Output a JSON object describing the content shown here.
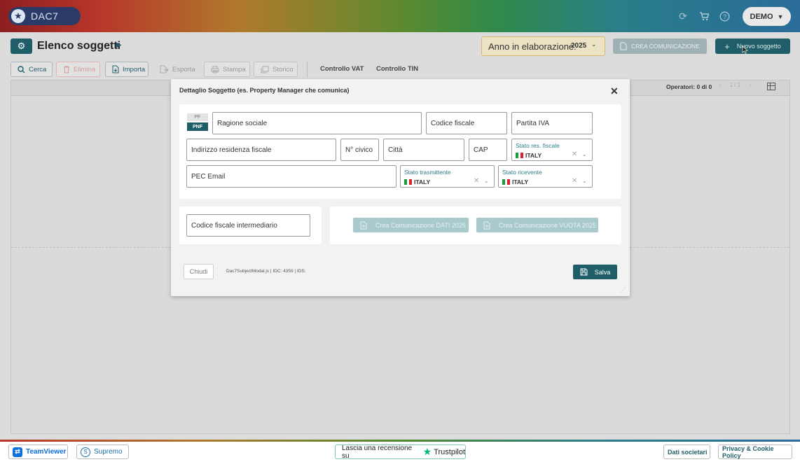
{
  "header": {
    "logo_text": "DAC7",
    "user_label": "DEMO",
    "icons": [
      "sync-icon",
      "cart-icon",
      "help-icon"
    ]
  },
  "title_bar": {
    "page_title": "Elenco soggetti",
    "anno_label": "Anno in elaborazione:",
    "anno_value": "2025",
    "crea_comunicazione_label": "CREA COMUNICAZIONE",
    "nuovo_soggetto_label": "Nuovo soggetto"
  },
  "toolbar": {
    "cerca": "Cerca",
    "elimina": "Elimina",
    "importa": "Importa",
    "esporta": "Esporta",
    "stampa": "Stampa",
    "storico": "Storico",
    "controllo_vat": "Controllo VAT",
    "controllo_tin": "Controllo TIN"
  },
  "table": {
    "operatori": "Operatori: 0 di 0",
    "page": "1 / 1"
  },
  "modal": {
    "title": "Dettaglio Soggetto (es. Property Manager che comunica)",
    "type_pf": "PF",
    "type_pnf": "PNF",
    "fields": {
      "ragione_sociale": "Ragione sociale",
      "codice_fiscale": "Codice fiscale",
      "partita_iva": "Partita IVA",
      "indirizzo": "Indirizzo residenza fiscale",
      "civico": "N° civico",
      "citta": "Città",
      "cap": "CAP",
      "pec": "PEC Email",
      "cf_intermediario": "Codice fiscale intermediario"
    },
    "selects": {
      "stato_res_label": "Stato res. fiscale",
      "stato_res_value": "ITALY",
      "stato_trasm_label": "Stato trasmittente",
      "stato_trasm_value": "ITALY",
      "stato_ric_label": "Stato ricevente",
      "stato_ric_value": "ITALY"
    },
    "btn_crea_dati": "Crea Comunicazione DATI 2025",
    "btn_crea_vuota": "Crea Comunicazione VUOTA 2025",
    "btn_chiudi": "Chiudi",
    "info": "Dac7SubjectModal.js | IDC: 4359 | IDS:",
    "btn_salva": "Salva"
  },
  "footer": {
    "teamviewer": "TeamViewer",
    "supremo": "Supremo",
    "review_text": "Lascia una recensione su",
    "trustpilot": "Trustpilot",
    "dati_societari": "Dati societari",
    "privacy": "Privacy & Cookie Policy"
  },
  "colors": {
    "brand": "#1f5e68",
    "accent_label": "#2a7d8a",
    "disabled_button": "#a9cacd",
    "trustpilot_green": "#00b67a"
  }
}
